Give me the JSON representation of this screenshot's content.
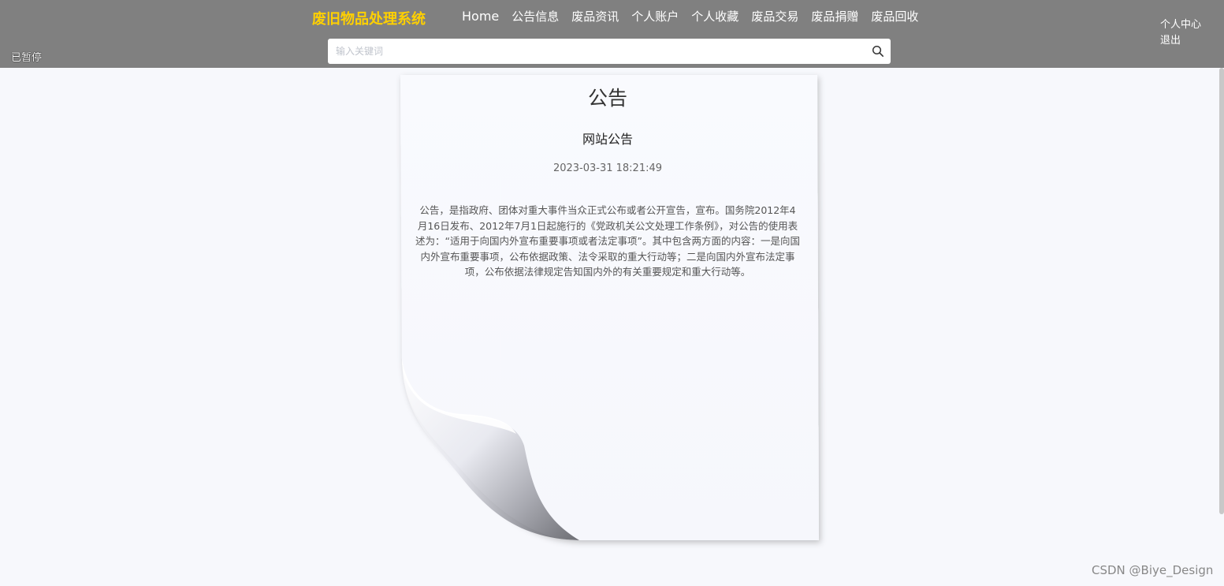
{
  "header": {
    "brand": "废旧物品处理系统",
    "nav": [
      {
        "label": "Home"
      },
      {
        "label": "公告信息"
      },
      {
        "label": "废品资讯"
      },
      {
        "label": "个人账户"
      },
      {
        "label": "个人收藏"
      },
      {
        "label": "废品交易"
      },
      {
        "label": "废品捐赠"
      },
      {
        "label": "废品回收"
      }
    ],
    "user_center": "个人中心",
    "logout": "退出",
    "paused_status": "已暂停"
  },
  "search": {
    "placeholder": "输入关键词",
    "value": "",
    "icon": "search-icon"
  },
  "notice": {
    "page_title": "公告",
    "title": "网站公告",
    "time": "2023-03-31 18:21:49",
    "body": "公告，是指政府、团体对重大事件当众正式公布或者公开宣告，宣布。国务院2012年4月16日发布、2012年7月1日起施行的《党政机关公文处理工作条例》，对公告的使用表述为：“适用于向国内外宣布重要事项或者法定事项”。其中包含两方面的内容：一是向国内外宣布重要事项，公布依据政策、法令采取的重大行动等；二是向国内外宣布法定事项，公布依据法律规定告知国内外的有关重要规定和重大行动等。"
  },
  "watermark": "CSDN @Biye_Design",
  "colors": {
    "header_bg": "#808080",
    "brand": "#ffd000",
    "page_bg": "#f7f8fc"
  }
}
